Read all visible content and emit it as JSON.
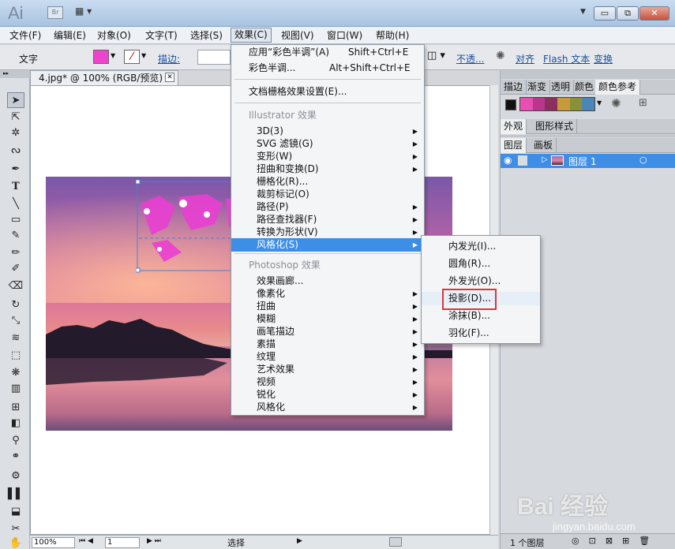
{
  "app": {
    "logo": "Ai",
    "br": "Br"
  },
  "window_controls": {
    "minimize": "▭",
    "restore": "⧉",
    "close": "✕"
  },
  "menubar": [
    "文件(F)",
    "编辑(E)",
    "对象(O)",
    "文字(T)",
    "选择(S)",
    "效果(C)",
    "视图(V)",
    "窗口(W)",
    "帮助(H)"
  ],
  "control_bar": {
    "mode": "文字",
    "stroke_label": "描边:",
    "opacity_label": "不透...",
    "align": "对齐",
    "flash_text": "Flash 文本",
    "transform": "变换",
    "fill_color": "#ee44cc"
  },
  "document": {
    "tab": "4.jpg* @ 100% (RGB/预览)",
    "tab_close": "✕"
  },
  "effect_menu": {
    "apply_last": "应用“彩色半调”(A)",
    "apply_last_sc": "Shift+Ctrl+E",
    "last": "彩色半调...",
    "last_sc": "Alt+Shift+Ctrl+E",
    "raster_settings": "文档栅格效果设置(E)...",
    "illustrator_header": "Illustrator 效果",
    "illustrator_items": [
      "3D(3)",
      "SVG 滤镜(G)",
      "变形(W)",
      "扭曲和变换(D)",
      "栅格化(R)...",
      "裁剪标记(O)",
      "路径(P)",
      "路径查找器(F)",
      "转换为形状(V)",
      "风格化(S)"
    ],
    "illustrator_arrows": [
      true,
      true,
      true,
      true,
      false,
      false,
      true,
      true,
      true,
      true
    ],
    "photoshop_header": "Photoshop 效果",
    "photoshop_items": [
      "效果画廊...",
      "像素化",
      "扭曲",
      "模糊",
      "画笔描边",
      "素描",
      "纹理",
      "艺术效果",
      "视频",
      "锐化",
      "风格化"
    ],
    "photoshop_arrows": [
      false,
      true,
      true,
      true,
      true,
      true,
      true,
      true,
      true,
      true,
      true
    ]
  },
  "stylize_submenu": [
    "内发光(I)...",
    "圆角(R)...",
    "外发光(O)...",
    "投影(D)...",
    "涂抹(B)...",
    "羽化(F)..."
  ],
  "right_panel": {
    "tabs1": [
      "描边",
      "渐变",
      "透明",
      "颜色",
      "颜色参考"
    ],
    "tabs2": [
      "外观",
      "图形样式"
    ],
    "tabs3": [
      "图层",
      "画板"
    ],
    "layer_name": "图层 1",
    "layer_count": "1 个图层",
    "swatches": [
      "#e84fb3",
      "#b8368c",
      "#8a2f5e",
      "#c79a3a",
      "#8a8f3a",
      "#4c86b8"
    ]
  },
  "status": {
    "zoom": "100%",
    "page": "1",
    "tool": "选择"
  },
  "watermark": {
    "brand": "Bai 经验",
    "url": "jingyan.baidu.com"
  },
  "highlight_color": "#d9383a"
}
